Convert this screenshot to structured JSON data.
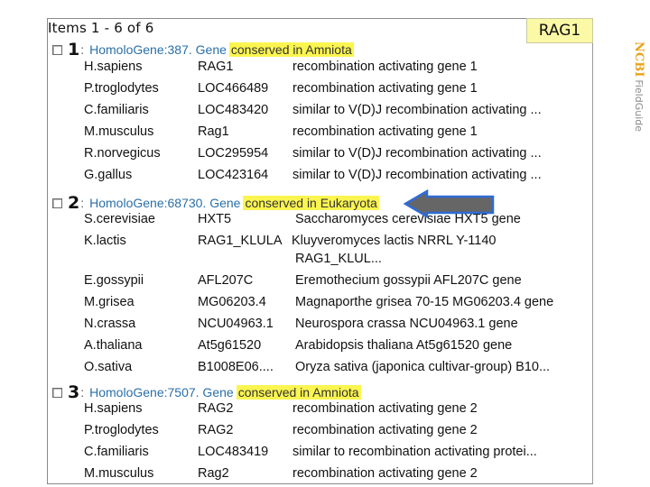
{
  "header": {
    "items_count": "Items 1 - 6 of 6",
    "query_tag": "RAG1"
  },
  "brand": {
    "ncbi": "NCBI",
    "field_guide": "FieldGuide"
  },
  "colors": {
    "highlight": "#fbf550",
    "link": "#2a6fa8",
    "tag_bg": "#fbf8a6",
    "brand_orange": "#e8a21a",
    "arrow_fill": "#666666",
    "arrow_stroke": "#2f6bd6"
  },
  "groups": [
    {
      "number": "1",
      "colon": ":",
      "link": "HomoloGene:387. Gene",
      "highlight": "conserved in Amniota",
      "rows": [
        {
          "species": "H.sapiens",
          "symbol": "RAG1",
          "description": "recombination activating gene 1"
        },
        {
          "species": "P.troglodytes",
          "symbol": "LOC466489",
          "description": "recombination activating gene 1"
        },
        {
          "species": "C.familiaris",
          "symbol": "LOC483420",
          "description": "similar to V(D)J recombination activating ..."
        },
        {
          "species": "M.musculus",
          "symbol": "Rag1",
          "description": "recombination activating gene 1"
        },
        {
          "species": "R.norvegicus",
          "symbol": "LOC295954",
          "description": "similar to V(D)J recombination activating ..."
        },
        {
          "species": "G.gallus",
          "symbol": "LOC423164",
          "description": "similar to V(D)J recombination activating ..."
        }
      ]
    },
    {
      "number": "2",
      "colon": ":",
      "link": "HomoloGene:68730. Gene",
      "highlight": "conserved in Eukaryota",
      "rows": [
        {
          "species": "S.cerevisiae",
          "symbol": "HXT5",
          "description": "Saccharomyces cerevisiae HXT5 gene"
        },
        {
          "species": "K.lactis",
          "symbol": "RAG1_KLULA",
          "description": "Kluyveromyces lactis NRRL Y-1140",
          "description2": "RAG1_KLUL..."
        },
        {
          "species": "E.gossypii",
          "symbol": "AFL207C",
          "description": "Eremothecium gossypii AFL207C gene"
        },
        {
          "species": "M.grisea",
          "symbol": "MG06203.4",
          "description": "Magnaporthe grisea 70-15 MG06203.4 gene"
        },
        {
          "species": "N.crassa",
          "symbol": "NCU04963.1",
          "description": "Neurospora crassa NCU04963.1 gene"
        },
        {
          "species": "A.thaliana",
          "symbol": "At5g61520",
          "description": "Arabidopsis thaliana At5g61520 gene"
        },
        {
          "species": "O.sativa",
          "symbol": "B1008E06....",
          "description": "Oryza sativa (japonica cultivar-group) B10..."
        }
      ]
    },
    {
      "number": "3",
      "colon": ":",
      "link": "HomoloGene:7507. Gene",
      "highlight": "conserved in Amniota",
      "rows": [
        {
          "species": "H.sapiens",
          "symbol": "RAG2",
          "description": "recombination activating gene 2"
        },
        {
          "species": "P.troglodytes",
          "symbol": "RAG2",
          "description": "recombination activating gene 2"
        },
        {
          "species": "C.familiaris",
          "symbol": "LOC483419",
          "description": "similar to recombination activating protei..."
        },
        {
          "species": "M.musculus",
          "symbol": "Rag2",
          "description": "recombination activating gene 2"
        }
      ]
    }
  ]
}
